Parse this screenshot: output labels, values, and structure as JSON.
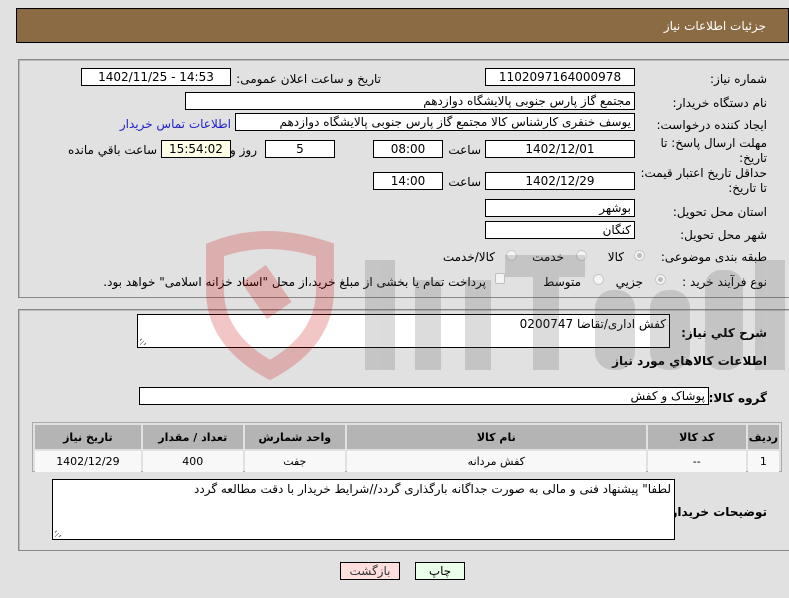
{
  "header": {
    "title": "جزئیات اطلاعات نیاز"
  },
  "details": {
    "need_number_label": "شماره نیاز:",
    "need_number": "1102097164000978",
    "announce_label": "تاریخ و ساعت اعلان عمومی:",
    "announce_value": "1402/11/25 - 14:53",
    "buyer_org_label": "نام دستگاه خریدار:",
    "buyer_org": "مجتمع گاز پارس جنوبی  پالایشگاه دوازدهم",
    "creator_label": "ایجاد کننده درخواست:",
    "creator": "یوسف خنفری کارشناس کالا مجتمع گاز پارس جنوبی  پالایشگاه دوازدهم",
    "contact_link": "اطلاعات تماس خریدار",
    "reply_deadline_label": "مهلت ارسال پاسخ: تا تاریخ:",
    "reply_date": "1402/12/01",
    "time_label": "ساعت",
    "reply_time": "08:00",
    "days_value": "5",
    "days_label": "روز و",
    "remaining_time": "15:54:02",
    "remaining_label": "ساعت باقي مانده",
    "price_validity_label": "حداقل تاریخ اعتبار قیمت: تا تاریخ:",
    "price_date": "1402/12/29",
    "price_time": "14:00",
    "province_label": "استان محل تحویل:",
    "province": "بوشهر",
    "city_label": "شهر محل تحویل:",
    "city": "کنگان",
    "category_label": "طبقه بندی موضوعی:",
    "category_options": [
      "کالا",
      "خدمت",
      "کالا/خدمت"
    ],
    "category_selected": "کالا",
    "purchase_type_label": "نوع فرآیند خرید :",
    "purchase_options": [
      "جزیي",
      "متوسط"
    ],
    "purchase_selected": "جزیي",
    "treasury_checkbox_label": "پرداخت تمام یا بخشی از مبلغ خرید،از محل \"اسناد خزانه اسلامی\" خواهد بود."
  },
  "summary": {
    "description_label": "شرح کلي نیاز:",
    "description": "کفش اداری/تقاضا 0200747",
    "items_heading": "اطلاعات کالاهاي مورد نیاز",
    "group_label": "گروه کالا:",
    "group_value": "پوشاک و کفش"
  },
  "table": {
    "headers": [
      "ردیف",
      "کد کالا",
      "نام کالا",
      "واحد شمارش",
      "تعداد / مقدار",
      "تاریخ نیاز"
    ],
    "rows": [
      [
        "1",
        "--",
        "کفش مردانه",
        "جفت",
        "400",
        "1402/12/29"
      ]
    ]
  },
  "notes": {
    "label": "توضیحات خریدار:",
    "text": "لطفا\" پیشنهاد فنی و مالی به صورت جداگانه بارگذاری گردد//شرایط خریدار با دقت مطالعه گردد"
  },
  "buttons": {
    "print": "چاپ",
    "back": "بازگشت"
  },
  "colors": {
    "header_bg": "#8b6b43",
    "print_bg": "#eaffea",
    "back_bg": "#ffdede",
    "link": "#2222cc"
  }
}
